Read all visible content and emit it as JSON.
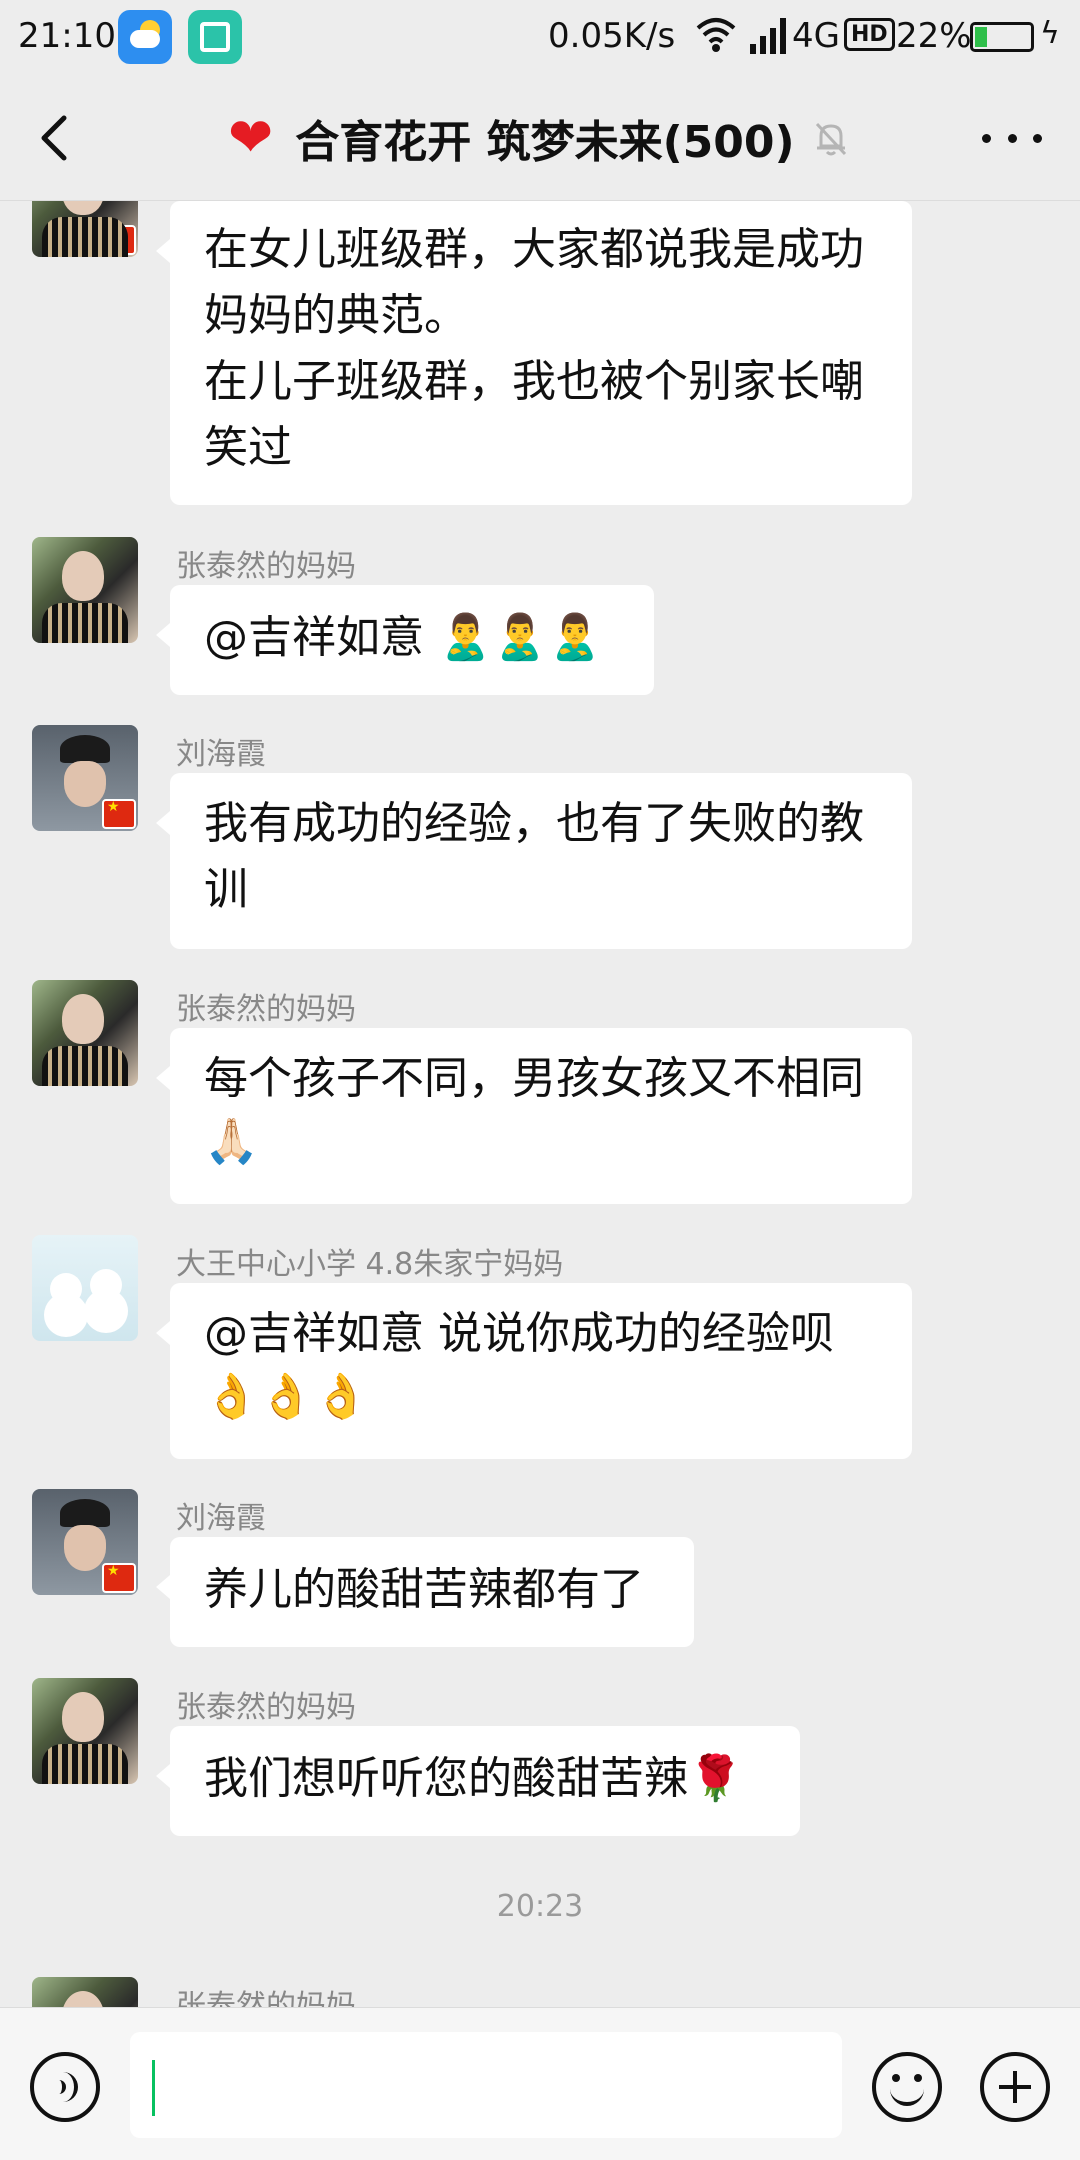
{
  "status_bar": {
    "time": "21:10",
    "net_speed": "0.05K/s",
    "network": "4G",
    "hd": "HD",
    "battery_percent": "22%",
    "battery_level": 0.22,
    "icons": [
      "weather-icon",
      "scan-icon",
      "wifi-icon",
      "signal-icon",
      "battery-icon",
      "charging-icon"
    ]
  },
  "header": {
    "heart": "❤",
    "title": "合育花开 筑梦未来(500)",
    "icons": [
      "back-icon",
      "mute-icon",
      "more-icon"
    ]
  },
  "messages": [
    {
      "sender": "",
      "avatar": "a",
      "lines": [
        "在女儿班级群，大家都说我是成功",
        "妈妈的典范。",
        "在儿子班级群，我也被个别家长嘲",
        "笑过"
      ],
      "emoji": ""
    },
    {
      "sender": "张泰然的妈妈",
      "avatar": "a",
      "lines": [
        "@吉祥如意 🙎‍♂️🙎‍♂️🙎‍♂️"
      ],
      "emoji": ""
    },
    {
      "sender": "刘海霞",
      "avatar": "b",
      "lines": [
        "我有成功的经验，也有了失败的教",
        "训"
      ],
      "emoji": ""
    },
    {
      "sender": "张泰然的妈妈",
      "avatar": "a",
      "lines": [
        "每个孩子不同，男孩女孩又不相同"
      ],
      "emoji": "🙏🏻"
    },
    {
      "sender": "大王中心小学 4.8朱家宁妈妈",
      "avatar": "c",
      "lines": [
        "@吉祥如意  说说你成功的经验呗"
      ],
      "emoji": "👌👌👌"
    },
    {
      "sender": "刘海霞",
      "avatar": "b",
      "lines": [
        "养儿的酸甜苦辣都有了"
      ],
      "emoji": ""
    },
    {
      "sender": "张泰然的妈妈",
      "avatar": "a",
      "lines": [
        "我们想听听您的酸甜苦辣🌹"
      ],
      "emoji": ""
    }
  ],
  "timestamp": "20:23",
  "last_partial_sender": "张泰然的妈妈",
  "input": {
    "value": "",
    "icons": [
      "voice-icon",
      "emoji-icon",
      "plus-icon"
    ]
  }
}
